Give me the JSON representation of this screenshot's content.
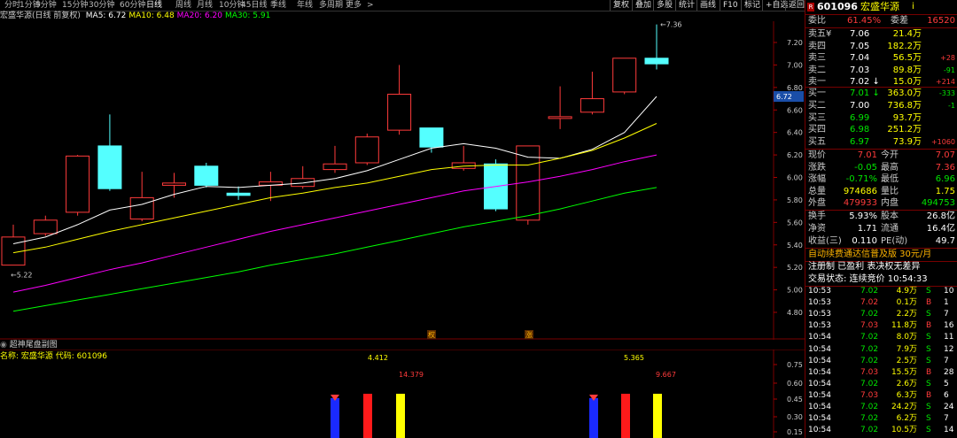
{
  "toolbar": {
    "periods": [
      "分时",
      "1分钟",
      "5分钟",
      "15分钟",
      "30分钟",
      "60分钟",
      "日线",
      "周线",
      "月线",
      "10分钟",
      "45日线",
      "季线",
      "年线",
      "多周期",
      "更多"
    ],
    "active_period": "日线",
    "more_arrow": ">",
    "right_buttons": [
      "复权",
      "叠加",
      "多股",
      "统计",
      "画线",
      "F10",
      "标记",
      "+自选",
      "返回"
    ]
  },
  "ma_line": {
    "title": "宏盛华源(日线 前复权)",
    "items": [
      {
        "label": "MA5: 6.72",
        "color": "#ffffff"
      },
      {
        "label": "MA10: 6.48",
        "color": "#ffff00"
      },
      {
        "label": "MA20: 6.20",
        "color": "#ff00ff"
      },
      {
        "label": "MA30: 5.91",
        "color": "#00ff00"
      }
    ]
  },
  "main_chart": {
    "y_ticks": [
      "7.20",
      "7.00",
      "6.80",
      "6.60",
      "6.40",
      "6.20",
      "6.00",
      "5.80",
      "5.60",
      "5.40",
      "5.20",
      "5.00",
      "4.80"
    ],
    "current_price_tag": "6.72",
    "high_annotation": "7.36",
    "low_annotation": "5.22",
    "event_markers": [
      "权",
      "涨"
    ]
  },
  "chart_data": {
    "type": "candlestick",
    "ylim": [
      4.7,
      7.5
    ],
    "candles": [
      {
        "o": 5.22,
        "c": 5.47,
        "h": 5.58,
        "l": 5.22,
        "color": "red"
      },
      {
        "o": 5.5,
        "c": 5.62,
        "h": 5.66,
        "l": 5.48,
        "color": "red"
      },
      {
        "o": 5.69,
        "c": 6.19,
        "h": 6.2,
        "l": 5.66,
        "color": "red"
      },
      {
        "o": 6.28,
        "c": 5.9,
        "h": 6.56,
        "l": 5.88,
        "color": "cyan"
      },
      {
        "o": 5.63,
        "c": 5.82,
        "h": 6.05,
        "l": 5.61,
        "color": "red"
      },
      {
        "o": 5.93,
        "c": 5.95,
        "h": 6.04,
        "l": 5.82,
        "color": "red"
      },
      {
        "o": 6.1,
        "c": 5.93,
        "h": 6.13,
        "l": 5.91,
        "color": "cyan"
      },
      {
        "o": 5.86,
        "c": 5.84,
        "h": 5.92,
        "l": 5.8,
        "color": "cyan"
      },
      {
        "o": 5.93,
        "c": 5.96,
        "h": 6.05,
        "l": 5.79,
        "color": "red"
      },
      {
        "o": 5.92,
        "c": 5.99,
        "h": 6.1,
        "l": 5.9,
        "color": "red"
      },
      {
        "o": 6.07,
        "c": 6.12,
        "h": 6.28,
        "l": 6.04,
        "color": "red"
      },
      {
        "o": 6.13,
        "c": 6.36,
        "h": 6.39,
        "l": 6.11,
        "color": "red"
      },
      {
        "o": 6.42,
        "c": 6.74,
        "h": 7.0,
        "l": 6.38,
        "color": "red"
      },
      {
        "o": 6.44,
        "c": 6.27,
        "h": 6.44,
        "l": 6.22,
        "color": "cyan"
      },
      {
        "o": 6.08,
        "c": 6.13,
        "h": 6.28,
        "l": 6.06,
        "color": "red"
      },
      {
        "o": 6.12,
        "c": 5.72,
        "h": 6.16,
        "l": 5.7,
        "color": "cyan"
      },
      {
        "o": 5.62,
        "c": 6.28,
        "h": 6.28,
        "l": 5.58,
        "color": "red"
      },
      {
        "o": 6.53,
        "c": 6.54,
        "h": 6.81,
        "l": 6.43,
        "color": "red"
      },
      {
        "o": 6.58,
        "c": 6.7,
        "h": 6.94,
        "l": 6.56,
        "color": "red"
      },
      {
        "o": 6.76,
        "c": 7.06,
        "h": 7.06,
        "l": 6.74,
        "color": "red"
      },
      {
        "o": 7.06,
        "c": 7.01,
        "h": 7.36,
        "l": 6.96,
        "color": "cyan"
      }
    ],
    "series": [
      {
        "name": "MA5",
        "color": "#ffffff",
        "values": [
          5.41,
          5.47,
          5.58,
          5.71,
          5.76,
          5.85,
          5.92,
          5.91,
          5.93,
          5.95,
          5.99,
          6.06,
          6.16,
          6.26,
          6.3,
          6.26,
          6.18,
          6.17,
          6.25,
          6.4,
          6.72
        ]
      },
      {
        "name": "MA10",
        "color": "#ffff00",
        "values": [
          5.33,
          5.38,
          5.45,
          5.52,
          5.58,
          5.64,
          5.7,
          5.76,
          5.82,
          5.86,
          5.91,
          5.95,
          6.01,
          6.07,
          6.1,
          6.11,
          6.11,
          6.17,
          6.24,
          6.35,
          6.48
        ]
      },
      {
        "name": "MA20",
        "color": "#ff00ff",
        "values": [
          4.98,
          5.04,
          5.11,
          5.18,
          5.24,
          5.31,
          5.38,
          5.45,
          5.52,
          5.58,
          5.64,
          5.7,
          5.76,
          5.82,
          5.88,
          5.92,
          5.96,
          6.01,
          6.07,
          6.14,
          6.2
        ]
      },
      {
        "name": "MA30",
        "color": "#00ff00",
        "values": [
          4.81,
          4.86,
          4.91,
          4.96,
          5.01,
          5.06,
          5.11,
          5.16,
          5.22,
          5.27,
          5.32,
          5.38,
          5.44,
          5.5,
          5.56,
          5.61,
          5.66,
          5.72,
          5.79,
          5.86,
          5.91
        ]
      }
    ]
  },
  "sub_chart": {
    "title": "超神尾盘副图",
    "meta": "名称: 宏盛华源 代码: 601096",
    "values": [
      {
        "text": "4.412",
        "color": "#ffff00"
      },
      {
        "text": "14.379",
        "color": "#ff3b3b"
      },
      {
        "text": "5.365",
        "color": "#ffff00"
      },
      {
        "text": "9.667",
        "color": "#ff3b3b"
      }
    ],
    "y_ticks": [
      "0.75",
      "0.60",
      "0.45",
      "0.30",
      "0.15"
    ],
    "bar_groups": [
      {
        "blue": true,
        "red": true,
        "yellow": true
      },
      {
        "blue": true,
        "red": true,
        "yellow": true
      }
    ]
  },
  "panel": {
    "stock_code": "601096",
    "stock_name": "宏盛华源",
    "info_mark": "i",
    "small_badge": "R",
    "wei_bi_label": "委比",
    "wei_bi_value": "61.45%",
    "wei_cha_label": "委差",
    "wei_cha_value": "16520",
    "asks": [
      {
        "label": "卖五",
        "mark": "¥",
        "price": "7.06",
        "vol": "21.4万",
        "chg": ""
      },
      {
        "label": "卖四",
        "mark": "",
        "price": "7.05",
        "vol": "182.2万",
        "chg": ""
      },
      {
        "label": "卖三",
        "mark": "",
        "price": "7.04",
        "vol": "56.5万",
        "chg": "+28"
      },
      {
        "label": "卖二",
        "mark": "",
        "price": "7.03",
        "vol": "89.8万",
        "chg": "-91"
      },
      {
        "label": "卖一",
        "mark": "",
        "price": "7.02",
        "vol": "15.0万",
        "chg": "+214",
        "arrow": "↓"
      }
    ],
    "bids": [
      {
        "label": "买一",
        "price": "7.01",
        "vol": "363.0万",
        "chg": "-333",
        "arrow": "↓"
      },
      {
        "label": "买二",
        "price": "7.00",
        "vol": "736.8万",
        "chg": "-1"
      },
      {
        "label": "买三",
        "price": "6.99",
        "vol": "93.7万",
        "chg": ""
      },
      {
        "label": "买四",
        "price": "6.98",
        "vol": "251.2万",
        "chg": ""
      },
      {
        "label": "买五",
        "price": "6.97",
        "vol": "73.9万",
        "chg": "+1060"
      }
    ],
    "stats": [
      {
        "l1": "现价",
        "v1": "7.01",
        "c1": "#ff3b3b",
        "l2": "今开",
        "v2": "7.07",
        "c2": "#ff3b3b"
      },
      {
        "l1": "涨跌",
        "v1": "-0.05",
        "c1": "#00e600",
        "l2": "最高",
        "v2": "7.36",
        "c2": "#ff3b3b"
      },
      {
        "l1": "涨幅",
        "v1": "-0.71%",
        "c1": "#00e600",
        "l2": "最低",
        "v2": "6.96",
        "c2": "#00e600"
      },
      {
        "l1": "总量",
        "v1": "974686",
        "c1": "#ffff00",
        "l2": "量比",
        "v2": "1.75",
        "c2": "#ffff00"
      },
      {
        "l1": "外盘",
        "v1": "479933",
        "c1": "#ff3b3b",
        "l2": "内盘",
        "v2": "494753",
        "c2": "#00e600"
      }
    ],
    "stats2": [
      {
        "l1": "换手",
        "v1": "5.93%",
        "l2": "股本",
        "v2": "26.8亿"
      },
      {
        "l1": "净资",
        "v1": "1.71",
        "l2": "流通",
        "v2": "16.4亿"
      },
      {
        "l1": "收益(三)",
        "v1": "0.110",
        "l2": "PE(动)",
        "v2": "49.7"
      }
    ],
    "promo": "自动续费通达信普及版 30元/月",
    "register": "注册制 已盈利 表决权无差异",
    "trade_status": "交易状态: 连续竞价 10:54:33",
    "ticks": [
      {
        "time": "10:53",
        "price": "7.02",
        "vol": "4.9万",
        "side": "S",
        "n": "10"
      },
      {
        "time": "10:53",
        "price": "7.02",
        "vol": "0.1万",
        "side": "B",
        "n": "1"
      },
      {
        "time": "10:53",
        "price": "7.02",
        "vol": "2.2万",
        "side": "S",
        "n": "7"
      },
      {
        "time": "10:53",
        "price": "7.03",
        "vol": "11.8万",
        "side": "B",
        "n": "16"
      },
      {
        "time": "10:54",
        "price": "7.02",
        "vol": "8.0万",
        "side": "S",
        "n": "11"
      },
      {
        "time": "10:54",
        "price": "7.02",
        "vol": "7.9万",
        "side": "S",
        "n": "12"
      },
      {
        "time": "10:54",
        "price": "7.02",
        "vol": "2.5万",
        "side": "S",
        "n": "7"
      },
      {
        "time": "10:54",
        "price": "7.03",
        "vol": "15.5万",
        "side": "B",
        "n": "28"
      },
      {
        "time": "10:54",
        "price": "7.02",
        "vol": "2.6万",
        "side": "S",
        "n": "5"
      },
      {
        "time": "10:54",
        "price": "7.03",
        "vol": "6.3万",
        "side": "B",
        "n": "6"
      },
      {
        "time": "10:54",
        "price": "7.02",
        "vol": "24.2万",
        "side": "S",
        "n": "24"
      },
      {
        "time": "10:54",
        "price": "7.02",
        "vol": "6.2万",
        "side": "S",
        "n": "7"
      },
      {
        "time": "10:54",
        "price": "7.02",
        "vol": "10.5万",
        "side": "S",
        "n": "14"
      }
    ]
  }
}
